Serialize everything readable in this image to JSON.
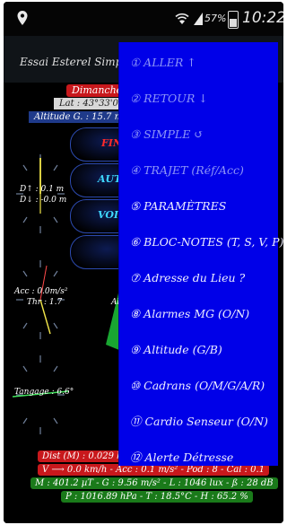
{
  "status_bar": {
    "battery_percent": "57%",
    "time": "10:22",
    "icons": [
      "location-pin-icon",
      "wifi-icon",
      "signal-icon",
      "battery-icon"
    ]
  },
  "header": {
    "title": "Essai Esterel Simple ↺"
  },
  "dashboard": {
    "date": "Dimanche -",
    "lat": "Lat : 43°33'00.7",
    "altitude": "Altitude G. : 15.7 m -",
    "buttons": [
      {
        "label": "FIN",
        "color": "#ff2a2a"
      },
      {
        "label": "AUT",
        "color": "#3fd8ff"
      },
      {
        "label": "VOI",
        "color": "#3fd8ff"
      },
      {
        "label": "",
        "color": "#3fd8ff"
      }
    ],
    "dial_top": {
      "line1": "D↑ : 0.1 m",
      "line2": "D↓ : -0.0 m"
    },
    "dial_mid": {
      "line1": "Acc : 0.0m/s²",
      "line2": "Thr : 1.7"
    },
    "dial_bottom": {
      "line1": "Tangage : 6.6°"
    },
    "green_label": "Al",
    "bottom_rows": [
      {
        "text": "Dist (M) : 0.029 km - ",
        "bg": "#c8181c"
      },
      {
        "text": "V ⟶ 0.0 km/h - Acc : 0.1 m/s² - Pod : 8 - Cal : 0.1",
        "bg": "#c8181c"
      },
      {
        "text": "M : 401.2 µT - G : 9.56 m/s² - L : 1046 lux - ß : 28 dB",
        "bg": "#1a7a1a"
      },
      {
        "text": "P : 1016.89 hPa - T : 18.5°C - H : 65.2 %",
        "bg": "#1a7a1a"
      }
    ]
  },
  "menu": {
    "items": [
      {
        "label": "① ALLER ↑",
        "enabled": false
      },
      {
        "label": "② RETOUR ↓",
        "enabled": false
      },
      {
        "label": "③ SIMPLE ↺",
        "enabled": false
      },
      {
        "label": "④ TRAJET (Réf/Acc)",
        "enabled": false
      },
      {
        "label": "⑤ PARAMÈTRES",
        "enabled": true
      },
      {
        "label": "⑥ BLOC-NOTES (T, S, V, P)",
        "enabled": true
      },
      {
        "label": "⑦ Adresse du Lieu ?",
        "enabled": true
      },
      {
        "label": "⑧ Alarmes MG (O/N)",
        "enabled": true
      },
      {
        "label": "⑨ Altitude (G/B)",
        "enabled": true
      },
      {
        "label": "⑩ Cadrans (O/M/G/A/R)",
        "enabled": true
      },
      {
        "label": "⑪ Cardio Senseur (O/N)",
        "enabled": true
      },
      {
        "label": "⑫ Alerte Détresse",
        "enabled": true
      }
    ]
  }
}
